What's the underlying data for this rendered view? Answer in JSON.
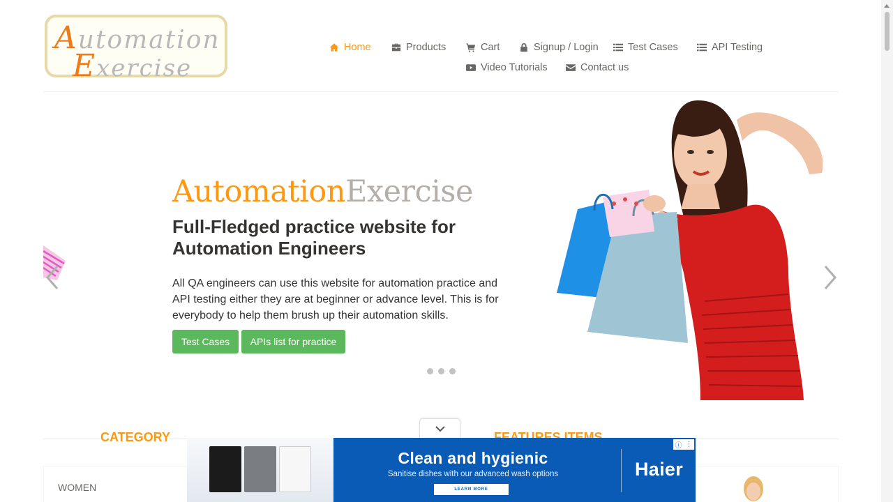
{
  "header": {
    "logo": {
      "line1_cap": "A",
      "line1_rest": "utomation",
      "line2_cap": "E",
      "line2_rest": "xercise"
    },
    "nav": [
      {
        "label": "Home",
        "icon": "home-icon",
        "active": true
      },
      {
        "label": "Products",
        "icon": "briefcase-icon"
      },
      {
        "label": "Cart",
        "icon": "cart-icon"
      },
      {
        "label": "Signup / Login",
        "icon": "lock-icon"
      },
      {
        "label": "Test Cases",
        "icon": "list-icon"
      },
      {
        "label": "API Testing",
        "icon": "list-icon"
      },
      {
        "label": "Video Tutorials",
        "icon": "youtube-icon"
      },
      {
        "label": "Contact us",
        "icon": "envelope-icon"
      }
    ]
  },
  "slider": {
    "brand_a": "Automation",
    "brand_b": "Exercise",
    "title": "Full-Fledged practice website for Automation Engineers",
    "description": "All QA engineers can use this website for automation practice and API testing either they are at beginner or advance level. This is for everybody to help them brush up their automation skills.",
    "buttons": {
      "test_cases": "Test Cases",
      "apis": "APIs list for practice"
    },
    "slide_count": 3
  },
  "sections": {
    "category_title": "CATEGORY",
    "features_title": "FEATURES ITEMS",
    "categories": [
      "WOMEN"
    ]
  },
  "ad": {
    "headline": "Clean and hygienic",
    "subtext": "Sanitise dishes with our advanced wash options",
    "cta": "LEARN MORE",
    "brand": "Haier"
  },
  "colors": {
    "accent": "#fe980f",
    "button_green": "#5cb85c",
    "text_dark": "#363432",
    "nav_text": "#696763",
    "ad_blue": "#0a5bb5"
  }
}
